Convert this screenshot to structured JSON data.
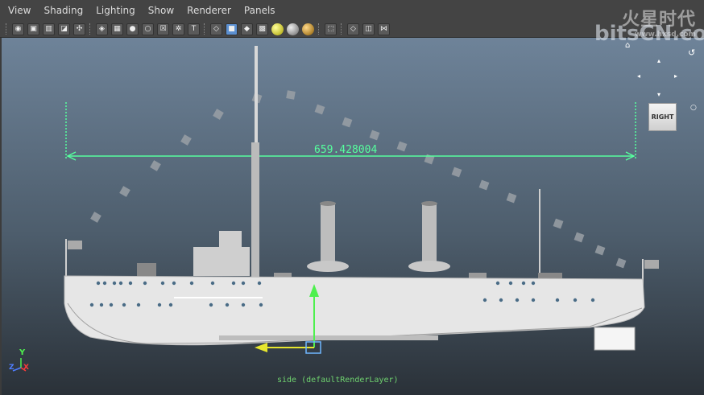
{
  "menubar": {
    "items": [
      "View",
      "Shading",
      "Lighting",
      "Show",
      "Renderer",
      "Panels"
    ]
  },
  "toolbar": {
    "icons": [
      "select-camera-icon",
      "camera-attributes-icon",
      "bookmarks-icon",
      "image-plane-icon",
      "2d-pan-zoom-icon",
      "grease-pencil-icon",
      "grid-icon",
      "film-gate-icon",
      "resolution-gate-icon",
      "gate-mask-icon",
      "field-chart-icon",
      "safe-action-icon",
      "safe-title-icon",
      "wireframe-icon",
      "smooth-shade-icon",
      "use-default-material-icon",
      "shade-selected-icon",
      "textured-icon",
      "lights-icon",
      "shadows-icon",
      "isolate-select-icon",
      "xray-icon",
      "xray-active-icon",
      "xray-joints-icon"
    ]
  },
  "watermark": {
    "logo": "火星时代",
    "site": "www.hxsd.com",
    "big": "bitsCN.com"
  },
  "viewcube": {
    "label": "RIGHT"
  },
  "viewport": {
    "distance_value": "659.428004",
    "camera_label": "side (defaultRenderLayer)"
  },
  "axes": {
    "y": "Y",
    "z": "Z",
    "x": "X"
  },
  "colors": {
    "measure": "#56ff9e",
    "manip_y": "#4ef04e",
    "manip_x": "#e6e62e",
    "manip_center": "#6fb7ff"
  }
}
